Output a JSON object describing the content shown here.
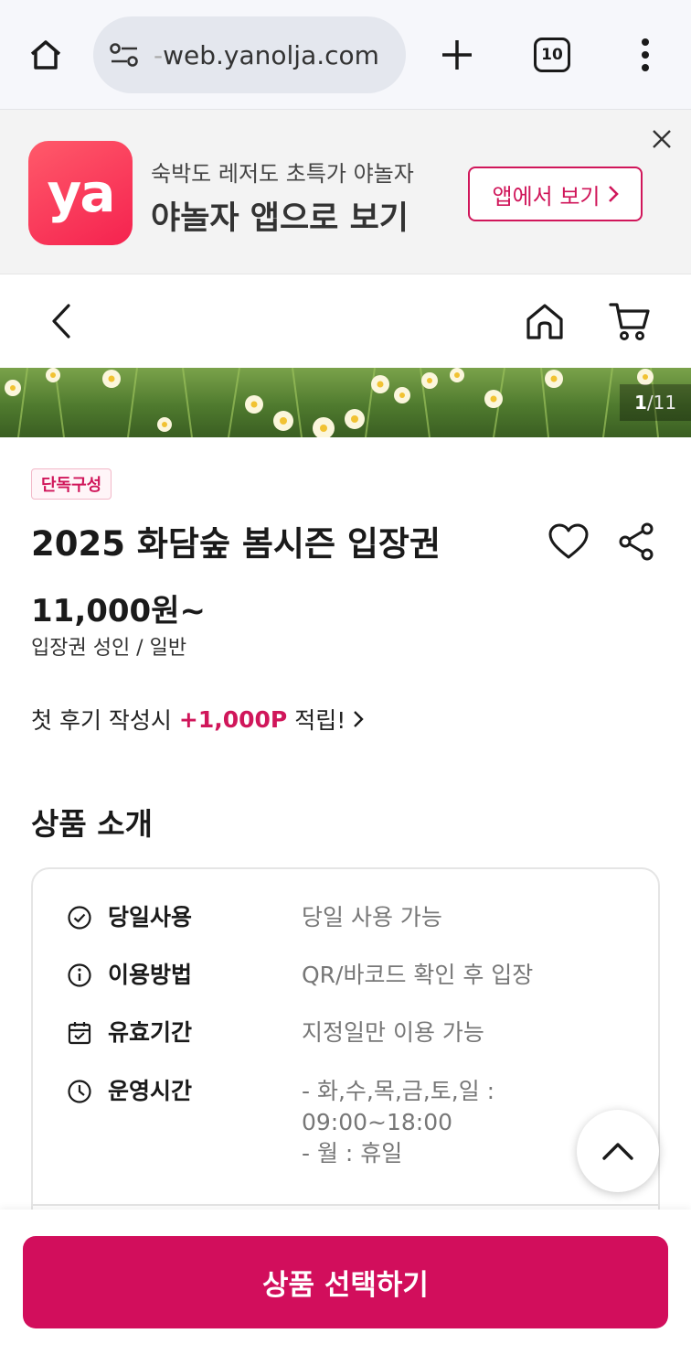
{
  "browser": {
    "url": "web.yanolja.com",
    "url_dash": "-",
    "tab_count": "10"
  },
  "app_banner": {
    "logo_text": "ya",
    "subtitle": "숙박도 레저도 초특가 야놀자",
    "title": "야놀자 앱으로 보기",
    "open_app_label": "앱에서 보기"
  },
  "hero": {
    "current": "1",
    "total": "/11"
  },
  "product": {
    "badge": "단독구성",
    "title": "2025 화담숲 봄시즌 입장권",
    "price": "11,000원~",
    "price_sub": "입장권 성인 / 일반"
  },
  "review_promo": {
    "prefix": "첫 후기 작성시",
    "points": "+1,000P",
    "suffix": "적립!"
  },
  "intro": {
    "section_title": "상품 소개",
    "rows": [
      {
        "icon": "check-circle-icon",
        "label": "당일사용",
        "value": "당일 사용 가능"
      },
      {
        "icon": "info-icon",
        "label": "이용방법",
        "value": "QR/바코드 확인 후 입장"
      },
      {
        "icon": "calendar-check-icon",
        "label": "유효기간",
        "value": "지정일만 이용 가능"
      },
      {
        "icon": "clock-icon",
        "label": "운영시간",
        "value": "- 화,수,목,금,토,일 :\n09:00~18:00\n- 월 : 휴일"
      }
    ]
  },
  "cta": {
    "label": "상품 선택하기"
  },
  "colors": {
    "brand": "#d20e5c",
    "logo_gradient_start": "#ff5a6a",
    "logo_gradient_end": "#f5224f"
  }
}
